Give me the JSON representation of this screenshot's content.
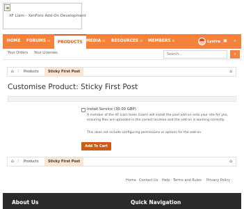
{
  "logo": {
    "alt_text": "XF Liam - XenForo Add-On Development"
  },
  "navbar": {
    "items": [
      {
        "label": "HOME"
      },
      {
        "label": "FORUMS ▫"
      },
      {
        "label": "PRODUCTS"
      },
      {
        "label": "MEDIA ▫"
      },
      {
        "label": "RESOURCES ▫"
      },
      {
        "label": "MEMBERS ▫"
      }
    ],
    "username": "Lystra",
    "alerts_icon": "bell-icon",
    "search_icon": "search-icon",
    "accent_color": "#f4823a"
  },
  "subnav": {
    "links": [
      {
        "label": "Your Orders"
      },
      {
        "label": "Your Licenses"
      }
    ],
    "search_placeholder": "Search..."
  },
  "breadcrumb": {
    "home_icon": "home-icon",
    "items": [
      {
        "label": "Products"
      },
      {
        "label": "Sticky First Post"
      }
    ]
  },
  "page": {
    "title": "Customise Product: Sticky First Post"
  },
  "option": {
    "label": "Install Service (30.00 GBP)",
    "description": "A member of the XF Liam team (Liam) will install the paid add-on onto your site for you, ensuring files are uploaded in the correct location and the add-on is working correctly.",
    "note": "This does not include configuring permissions or options for the add-on."
  },
  "add_to_cart_label": "Add To Cart",
  "footer_links": [
    {
      "label": "Home"
    },
    {
      "label": "Contact Us"
    },
    {
      "label": "Help"
    },
    {
      "label": "Terms and Rules"
    },
    {
      "label": "Privacy Policy"
    }
  ],
  "footer": {
    "about_heading": "About Us",
    "quicknav_heading": "Quick Navigation"
  }
}
